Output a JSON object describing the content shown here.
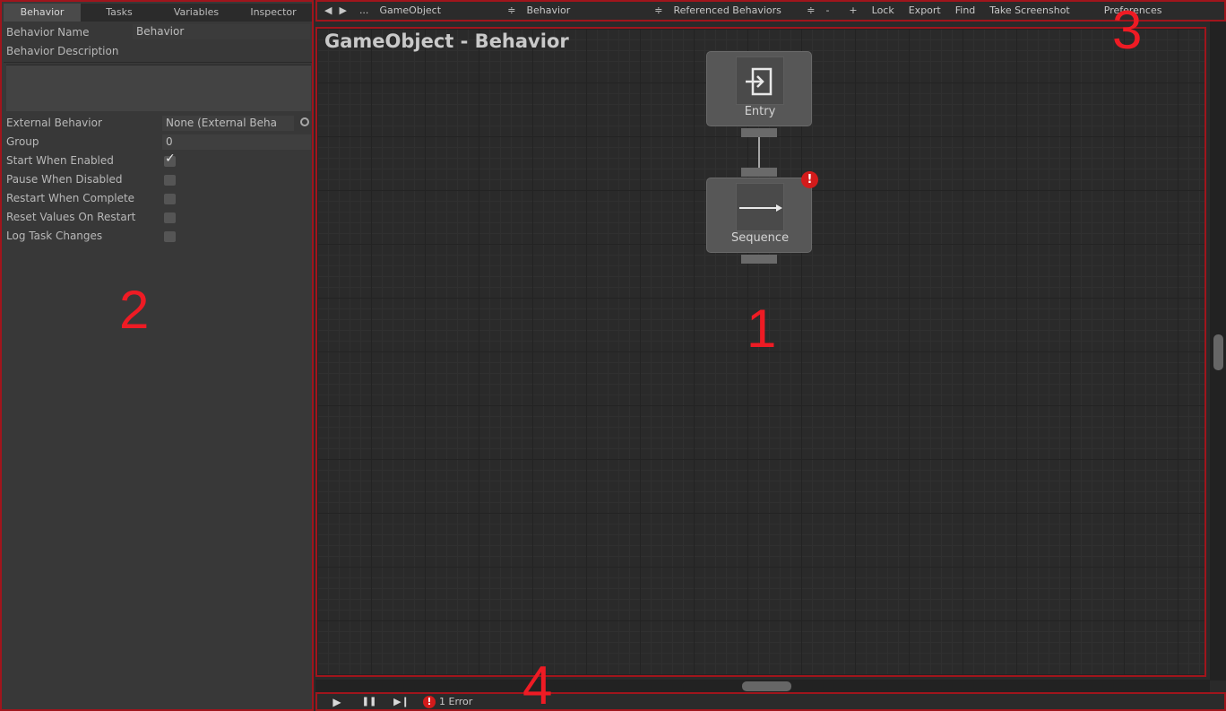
{
  "tabs": [
    {
      "label": "Behavior",
      "active": true
    },
    {
      "label": "Tasks",
      "active": false
    },
    {
      "label": "Variables",
      "active": false
    },
    {
      "label": "Inspector",
      "active": false
    }
  ],
  "properties": {
    "behavior_name_label": "Behavior Name",
    "behavior_name_value": "Behavior",
    "behavior_description_label": "Behavior Description",
    "external_behavior_label": "External Behavior",
    "external_behavior_value": "None (External Beha",
    "group_label": "Group",
    "group_value": "0",
    "toggles": [
      {
        "label": "Start When Enabled",
        "checked": true
      },
      {
        "label": "Pause When Disabled",
        "checked": false
      },
      {
        "label": "Restart When Complete",
        "checked": false
      },
      {
        "label": "Reset Values On Restart",
        "checked": false
      },
      {
        "label": "Log Task Changes",
        "checked": false
      }
    ]
  },
  "toolbar": {
    "back_icon": "◀",
    "forward_icon": "▶",
    "more": "...",
    "gameobject_select": "GameObject",
    "behavior_select": "Behavior",
    "referenced_select": "Referenced Behaviors",
    "dropdown_icon": "≑",
    "minus": "-",
    "plus": "+",
    "lock": "Lock",
    "export": "Export",
    "find": "Find",
    "screenshot": "Take Screenshot",
    "preferences": "Preferences"
  },
  "graph": {
    "title": "GameObject - Behavior",
    "nodes": {
      "entry": {
        "label": "Entry",
        "icon": "entry-icon"
      },
      "sequence": {
        "label": "Sequence",
        "icon": "sequence-arrow-icon",
        "error_icon": "!"
      }
    }
  },
  "bottombar": {
    "play_icon": "▶",
    "pause_icon": "❚❚",
    "step_icon": "▶❙",
    "error_icon": "!",
    "error_text": "1 Error"
  },
  "markers": [
    "1",
    "2",
    "3",
    "4"
  ],
  "colors": {
    "annotation_red": "#ee1b24",
    "frame_red": "#a0151c",
    "error_red": "#d31b1b"
  }
}
